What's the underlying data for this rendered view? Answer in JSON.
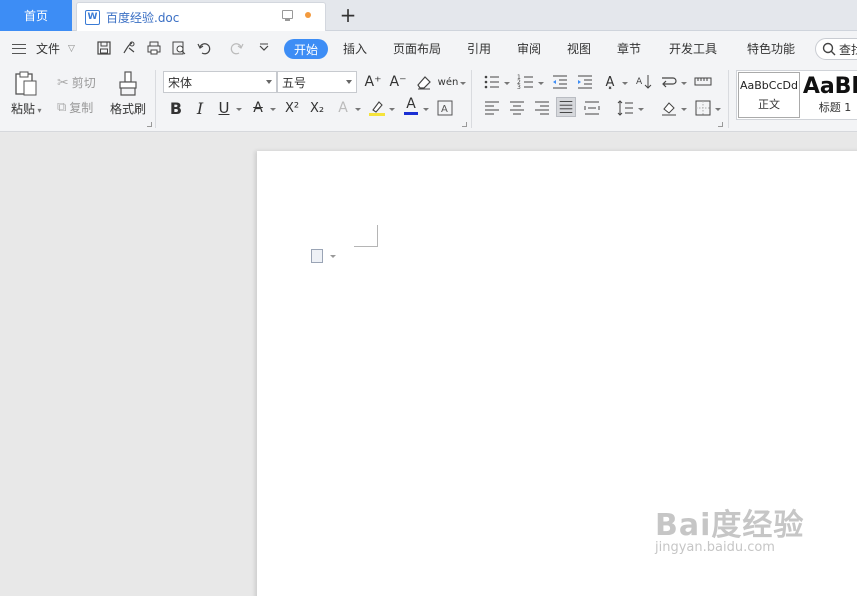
{
  "tabs": {
    "home": "首页",
    "doc_title": "百度经验.doc",
    "doc_icon_letter": "W",
    "add_label": "+"
  },
  "menu": {
    "file_label": "文件",
    "items": [
      "开始",
      "插入",
      "页面布局",
      "引用",
      "审阅",
      "视图",
      "章节",
      "开发工具",
      "特色功能"
    ],
    "search_label": "查找"
  },
  "ribbon": {
    "paste": "粘贴",
    "cut": "剪切",
    "copy": "复制",
    "format_painter": "格式刷",
    "font_family": "宋体",
    "font_size": "五号",
    "bold": "B",
    "italic": "I",
    "underline": "U",
    "strike": "A",
    "superscript": "X²",
    "subscript": "X₂",
    "font_color_letter": "A",
    "grow_font": "A⁺",
    "shrink_font": "A⁻",
    "phonetic": "wén",
    "style_normal_preview": "AaBbCcDd",
    "style_normal_label": "正文",
    "style_h1_preview": "AaBb",
    "style_h1_label": "标题 1"
  },
  "colors": {
    "accent": "#3d8df5",
    "highlight_yellow": "#f5e33b",
    "font_red": "#d33"
  },
  "watermark": {
    "main": "Bai度经验",
    "sub": "jingyan.baidu.com"
  }
}
